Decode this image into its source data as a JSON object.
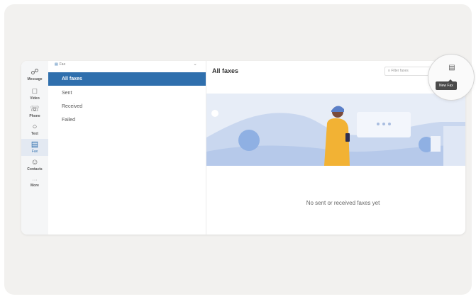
{
  "rail": {
    "items": [
      {
        "label": "Message",
        "icon": "message-icon"
      },
      {
        "label": "Video",
        "icon": "video-icon"
      },
      {
        "label": "Phone",
        "icon": "phone-icon"
      },
      {
        "label": "Text",
        "icon": "text-icon"
      },
      {
        "label": "Fax",
        "icon": "fax-icon"
      },
      {
        "label": "Contacts",
        "icon": "contacts-icon"
      }
    ],
    "more_label": "More"
  },
  "sidebar": {
    "header": "Fax",
    "items": [
      {
        "label": "All faxes"
      },
      {
        "label": "Sent"
      },
      {
        "label": "Received"
      },
      {
        "label": "Failed"
      }
    ]
  },
  "main": {
    "title": "All faxes",
    "filter_placeholder": "Filter faxes",
    "empty_message": "No sent or received faxes yet"
  },
  "new_fax": {
    "tooltip": "New Fax",
    "icon": "new-fax-icon"
  },
  "colors": {
    "accent": "#2f6fad",
    "background": "#f2f1ef"
  }
}
